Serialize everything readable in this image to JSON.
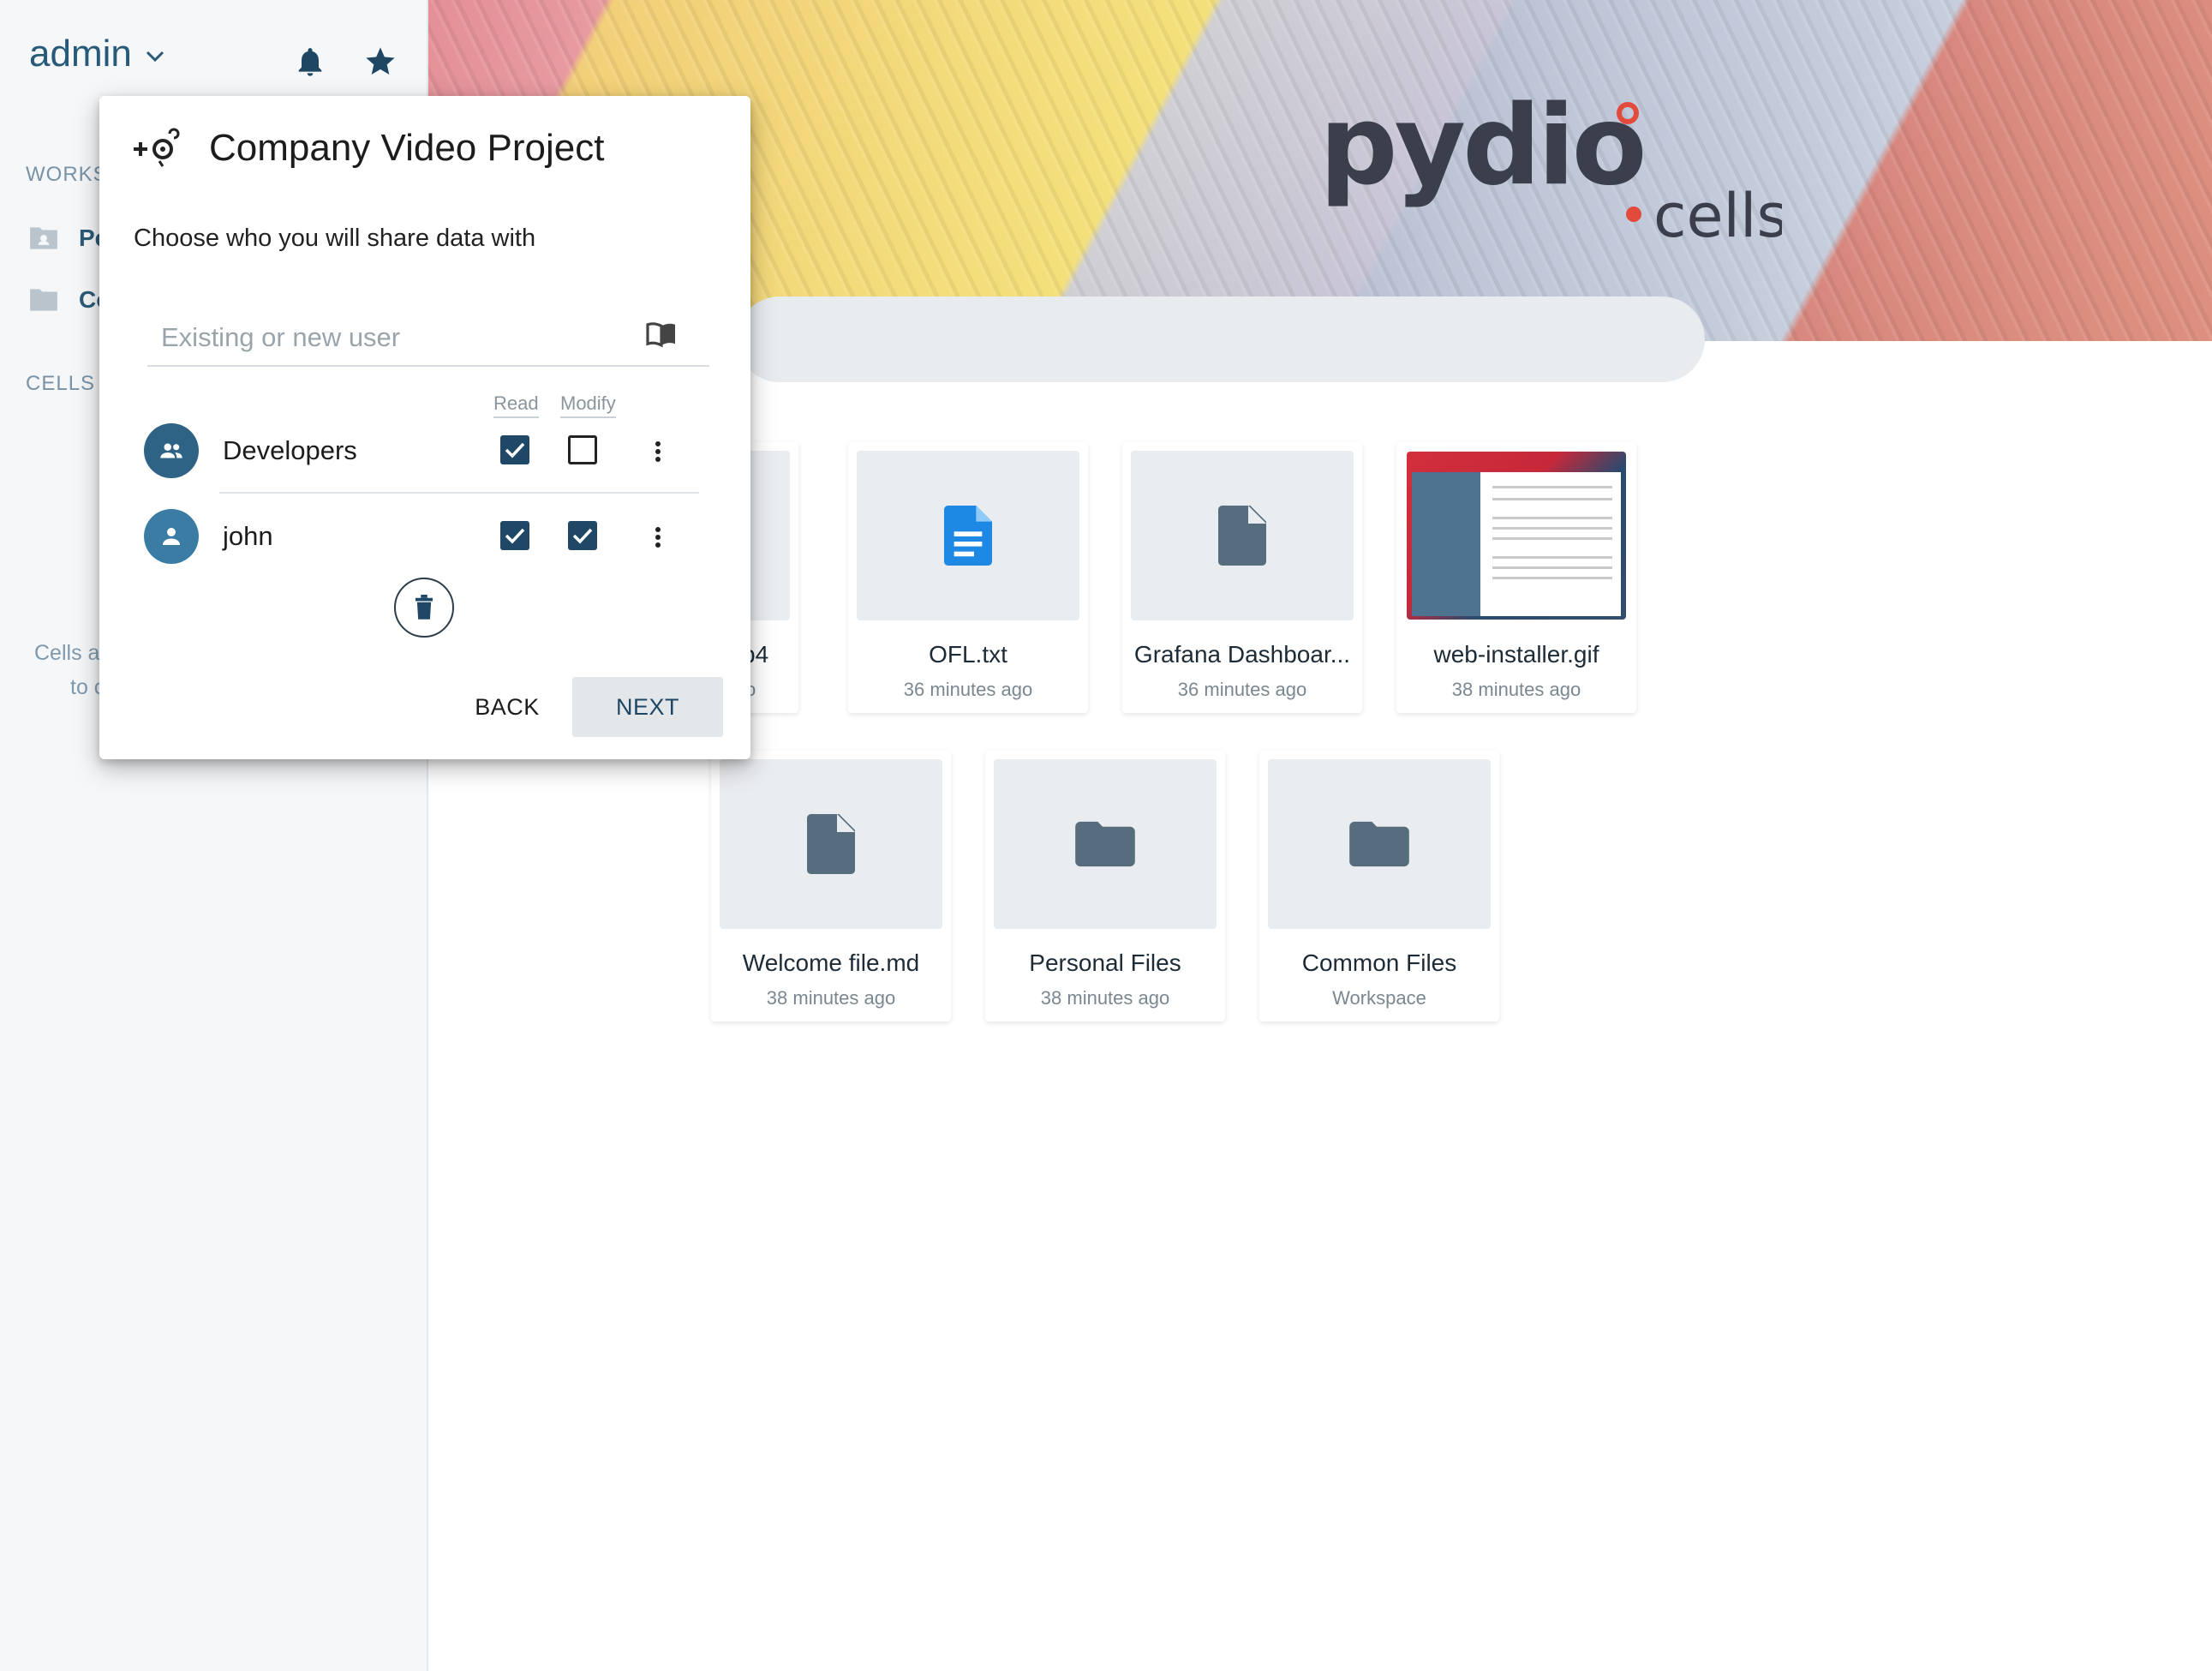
{
  "sidebar": {
    "user_label": "admin",
    "workspaces_heading": "WORKS",
    "items": [
      {
        "label": "Pe",
        "icon": "personal-folder-icon"
      },
      {
        "label": "Co",
        "icon": "folder-icon"
      }
    ],
    "cells_heading": "CELLS",
    "note_line1": "Cells a",
    "note_line2": "to c"
  },
  "header": {
    "logo_main": "pydio",
    "logo_sub": "cells"
  },
  "files": [
    {
      "name": "b4",
      "meta": "o",
      "icon": "file-icon"
    },
    {
      "name": "OFL.txt",
      "meta": "36 minutes ago",
      "icon": "text-document-icon"
    },
    {
      "name": "Grafana Dashboar...",
      "meta": "36 minutes ago",
      "icon": "file-icon"
    },
    {
      "name": "web-installer.gif",
      "meta": "38 minutes ago",
      "icon": "image-thumbnail"
    },
    {
      "name": "Welcome file.md",
      "meta": "38 minutes ago",
      "icon": "file-icon"
    },
    {
      "name": "Personal Files",
      "meta": "38 minutes ago",
      "icon": "folder-icon"
    },
    {
      "name": "Common Files",
      "meta": "Workspace",
      "icon": "folder-icon"
    }
  ],
  "dialog": {
    "title": "Company Video Project",
    "subtitle": "Choose who you will share data with",
    "search_placeholder": "Existing or new user",
    "col_read": "Read",
    "col_modify": "Modify",
    "rows": [
      {
        "name": "Developers",
        "type": "group",
        "read": true,
        "modify": false
      },
      {
        "name": "john",
        "type": "user",
        "read": true,
        "modify": true
      }
    ],
    "back_label": "BACK",
    "next_label": "NEXT"
  },
  "colors": {
    "accent": "#1e4866",
    "sidebar_bg": "#f5f7f9",
    "text_link": "#265a78"
  }
}
